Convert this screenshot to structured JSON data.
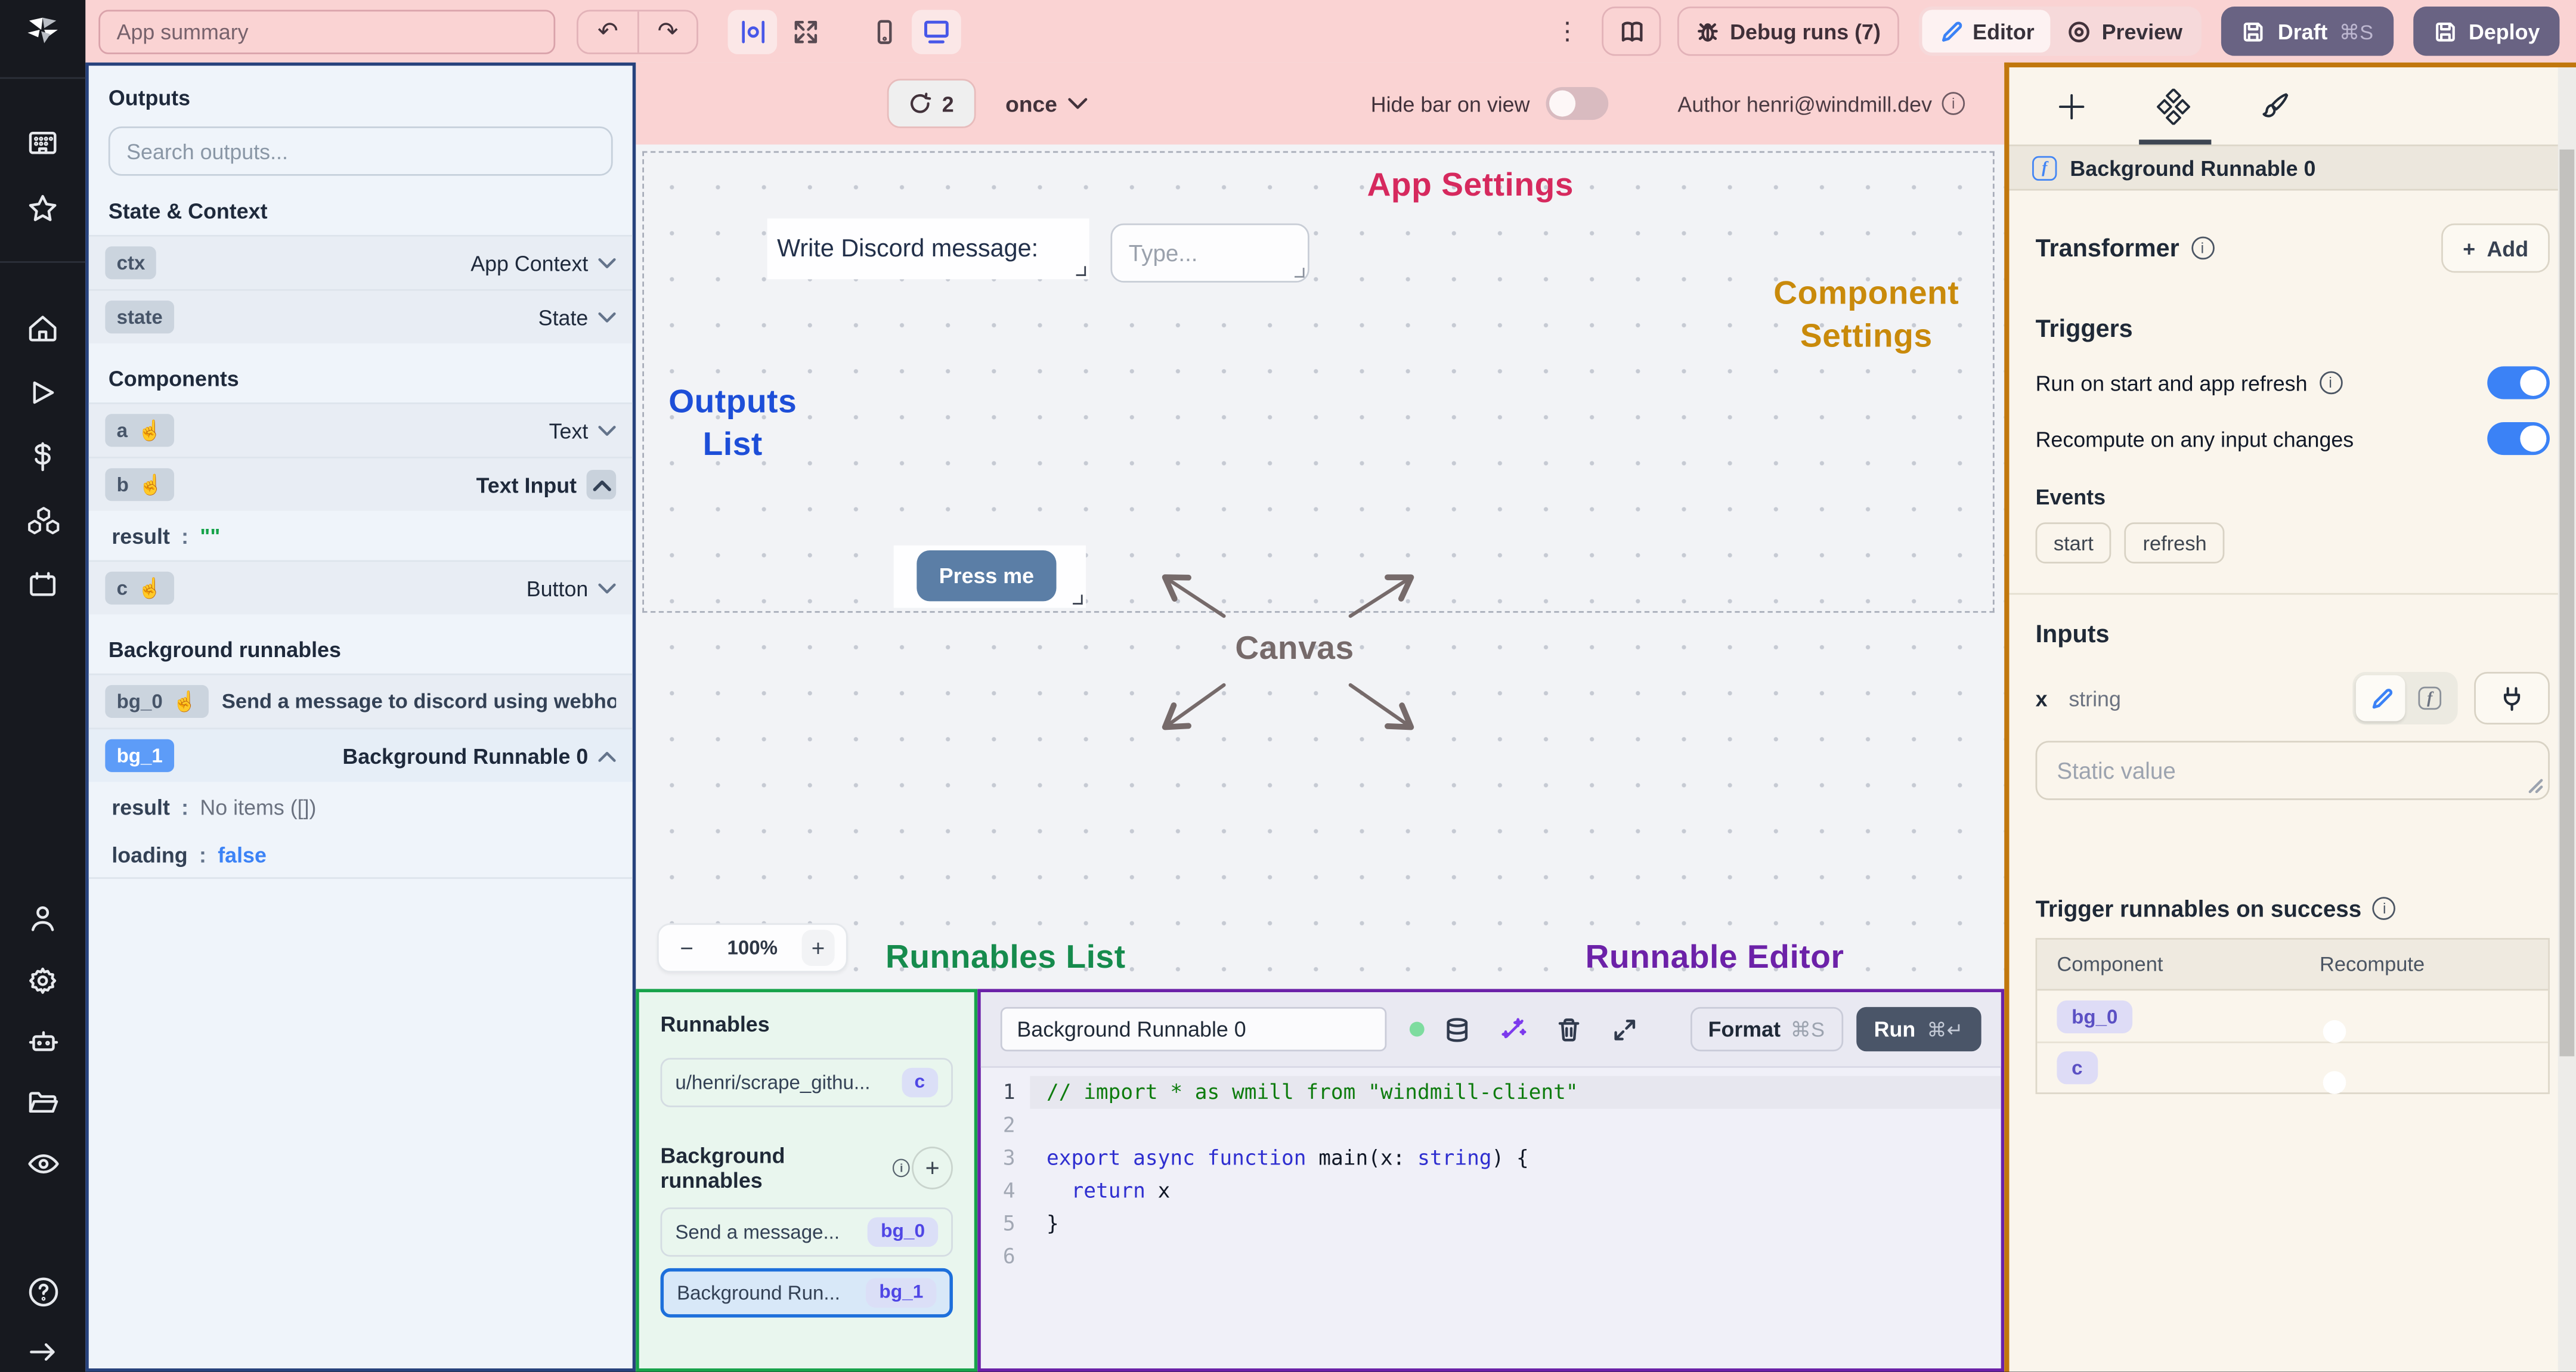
{
  "colors": {
    "topbar_pink": "#FAD3D3",
    "app_settings_red": "#D6295E",
    "component_settings_amber": "#C98A0B",
    "outputs_list_blue": "#1D4ED8",
    "runnables_list_green": "#168B4D",
    "runnable_editor_purple": "#6C21A8",
    "canvas_gray": "#766A6A",
    "outputs_border_navy": "#27427C",
    "right_panel_orange": "#C1770D",
    "toggle_on_blue": "#3B82F6",
    "dark_button": "#696383",
    "press_me_blue": "#5B7EA6"
  },
  "topbar": {
    "app_summary_placeholder": "App summary",
    "debug_runs": "Debug runs (7)",
    "editor": "Editor",
    "preview": "Preview",
    "draft": "Draft",
    "draft_shortcut": "⌘S",
    "deploy": "Deploy",
    "kebab": "⋮",
    "undo": "↶",
    "redo": "↷"
  },
  "outputs_panel": {
    "title": "Outputs",
    "search_placeholder": "Search outputs...",
    "sections": {
      "state_context": "State & Context",
      "components": "Components",
      "background_runnables": "Background runnables"
    },
    "rows": {
      "ctx": {
        "badge": "ctx",
        "type": "App Context"
      },
      "state": {
        "badge": "state",
        "type": "State"
      },
      "a": {
        "badge": "a",
        "type": "Text"
      },
      "b": {
        "badge": "b",
        "type": "Text Input"
      },
      "b_result": {
        "key": "result",
        "colon": ":",
        "value": "\"\""
      },
      "c": {
        "badge": "c",
        "type": "Button"
      },
      "bg0": {
        "badge": "bg_0",
        "label": "Send a message to discord using webhoo"
      },
      "bg1": {
        "badge": "bg_1",
        "label": "Background Runnable 0"
      },
      "bg1_result": {
        "key": "result",
        "colon": ":",
        "value": "No items ([])"
      },
      "bg1_loading": {
        "key": "loading",
        "colon": ":",
        "value": "false"
      }
    },
    "hand": "☝"
  },
  "canvas": {
    "bar": {
      "refresh_count": "2",
      "interval": "once",
      "hide_bar_label": "Hide bar on view",
      "author": "Author henri@windmill.dev",
      "info": "i"
    },
    "labels": {
      "app_settings": "App Settings",
      "component_settings": "Component Settings",
      "outputs_list": "Outputs List",
      "canvas": "Canvas",
      "runnables_list": "Runnables List",
      "runnable_editor": "Runnable Editor"
    },
    "widgets": {
      "discord_label": "Write Discord message:",
      "input_placeholder": "Type...",
      "button_label": "Press me"
    },
    "zoom": {
      "minus": "−",
      "level": "100%",
      "plus": "+"
    }
  },
  "runnables_panel": {
    "title": "Runnables",
    "item1": {
      "label": "u/henri/scrape_githu...",
      "badge": "c"
    },
    "bg_title": "Background runnables",
    "bg_info": "i",
    "plus": "+",
    "item2": {
      "label": "Send a message...",
      "badge": "bg_0"
    },
    "item3": {
      "label": "Background Run...",
      "badge": "bg_1"
    }
  },
  "editor_panel": {
    "name_value": "Background Runnable 0",
    "format_label": "Format",
    "format_shortcut": "⌘S",
    "run_label": "Run",
    "run_shortcut": "⌘↵",
    "line_numbers": [
      "1",
      "2",
      "3",
      "4",
      "5",
      "6"
    ],
    "code": {
      "lines": [
        [
          {
            "t": "// import * as wmill from \"windmill-client\"",
            "c": "cmt"
          }
        ],
        [],
        [
          {
            "t": "export",
            "c": "kw"
          },
          {
            "t": " ",
            "c": "pl"
          },
          {
            "t": "async",
            "c": "kw"
          },
          {
            "t": " ",
            "c": "pl"
          },
          {
            "t": "function",
            "c": "kw"
          },
          {
            "t": " main(x: ",
            "c": "pl"
          },
          {
            "t": "string",
            "c": "kw"
          },
          {
            "t": ") {",
            "c": "pl"
          }
        ],
        [
          {
            "t": "  ",
            "c": "pl"
          },
          {
            "t": "return",
            "c": "kw"
          },
          {
            "t": " x",
            "c": "pl"
          }
        ],
        [
          {
            "t": "}",
            "c": "pl"
          }
        ],
        []
      ]
    }
  },
  "right_panel": {
    "header": "Background Runnable 0",
    "f_icon": "f",
    "transformer_label": "Transformer",
    "info": "i",
    "plus": "+",
    "add_label": "Add",
    "triggers_label": "Triggers",
    "run_on_start_label": "Run on start and app refresh",
    "recompute_label": "Recompute on any input changes",
    "events_label": "Events",
    "chips": [
      "start",
      "refresh"
    ],
    "inputs_label": "Inputs",
    "input_name": "x",
    "input_type": "string",
    "static_placeholder": "Static value",
    "trigger_success_label": "Trigger runnables on success",
    "table": {
      "col1": "Component",
      "col2": "Recompute",
      "row1_badge": "bg_0",
      "row2_badge": "c"
    }
  }
}
